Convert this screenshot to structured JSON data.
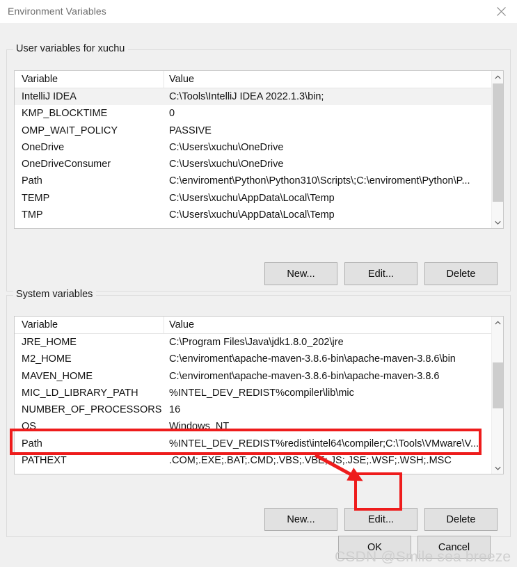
{
  "window": {
    "title": "Environment Variables",
    "close_icon": "close-icon"
  },
  "user_section": {
    "legend": "User variables for xuchu",
    "columns": {
      "variable": "Variable",
      "value": "Value"
    },
    "rows": [
      {
        "variable": "IntelliJ IDEA",
        "value": "C:\\Tools\\IntelliJ IDEA 2022.1.3\\bin;"
      },
      {
        "variable": "KMP_BLOCKTIME",
        "value": "0"
      },
      {
        "variable": "OMP_WAIT_POLICY",
        "value": "PASSIVE"
      },
      {
        "variable": "OneDrive",
        "value": "C:\\Users\\xuchu\\OneDrive"
      },
      {
        "variable": "OneDriveConsumer",
        "value": "C:\\Users\\xuchu\\OneDrive"
      },
      {
        "variable": "Path",
        "value": "C:\\enviroment\\Python\\Python310\\Scripts\\;C:\\enviroment\\Python\\P..."
      },
      {
        "variable": "TEMP",
        "value": "C:\\Users\\xuchu\\AppData\\Local\\Temp"
      },
      {
        "variable": "TMP",
        "value": "C:\\Users\\xuchu\\AppData\\Local\\Temp"
      }
    ],
    "buttons": {
      "new": "New...",
      "edit": "Edit...",
      "delete": "Delete"
    }
  },
  "system_section": {
    "legend": "System variables",
    "columns": {
      "variable": "Variable",
      "value": "Value"
    },
    "rows": [
      {
        "variable": "JRE_HOME",
        "value": "C:\\Program Files\\Java\\jdk1.8.0_202\\jre"
      },
      {
        "variable": "M2_HOME",
        "value": "C:\\enviroment\\apache-maven-3.8.6-bin\\apache-maven-3.8.6\\bin"
      },
      {
        "variable": "MAVEN_HOME",
        "value": "C:\\enviroment\\apache-maven-3.8.6-bin\\apache-maven-3.8.6"
      },
      {
        "variable": "MIC_LD_LIBRARY_PATH",
        "value": "%INTEL_DEV_REDIST%compiler\\lib\\mic"
      },
      {
        "variable": "NUMBER_OF_PROCESSORS",
        "value": "16"
      },
      {
        "variable": "OS",
        "value": "Windows_NT"
      },
      {
        "variable": "Path",
        "value": "%INTEL_DEV_REDIST%redist\\intel64\\compiler;C:\\Tools\\VMware\\V..."
      },
      {
        "variable": "PATHEXT",
        "value": ".COM;.EXE;.BAT;.CMD;.VBS;.VBE;.JS;.JSE;.WSF;.WSH;.MSC"
      }
    ],
    "buttons": {
      "new": "New...",
      "edit": "Edit...",
      "delete": "Delete"
    }
  },
  "footer": {
    "ok": "OK",
    "cancel": "Cancel"
  },
  "annotations": {
    "color": "#ee1c1c",
    "highlight_row": "Path",
    "highlight_button": "Edit...",
    "arrow": "arrow-pointing-to-edit-button"
  },
  "watermark": {
    "text": "CSDN @Smile sea breeze"
  }
}
